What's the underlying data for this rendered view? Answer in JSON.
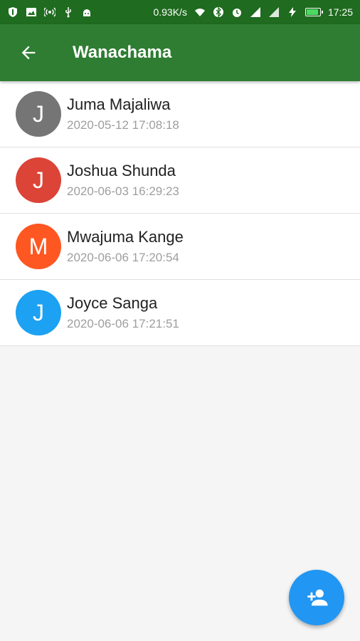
{
  "status_bar": {
    "network_speed": "0.93K/s",
    "time": "17:25",
    "battery_color": "#4cd964",
    "battery_level": 0.9,
    "left_icons": [
      "shield-icon",
      "image-icon",
      "hotspot-icon",
      "usb-icon",
      "android-icon"
    ],
    "right_icons": [
      "wifi-icon",
      "bluetooth-icon",
      "alarm-icon",
      "signal-icon",
      "signal-icon-2",
      "charging-icon",
      "battery-icon"
    ]
  },
  "app_bar": {
    "title": "Wanachama",
    "back_icon": "arrow-left-icon",
    "color": "#2e7d32"
  },
  "members": [
    {
      "initial": "J",
      "name": "Juma Majaliwa",
      "date": "2020-05-12 17:08:18",
      "color": "#757575"
    },
    {
      "initial": "J",
      "name": "Joshua Shunda",
      "date": "2020-06-03 16:29:23",
      "color": "#db4437"
    },
    {
      "initial": "M",
      "name": "Mwajuma Kange",
      "date": "2020-06-06 17:20:54",
      "color": "#ff5722"
    },
    {
      "initial": "J",
      "name": "Joyce Sanga",
      "date": "2020-06-06 17:21:51",
      "color": "#1da1f2"
    }
  ],
  "fab": {
    "icon": "add-person-icon",
    "color": "#2196f3"
  }
}
